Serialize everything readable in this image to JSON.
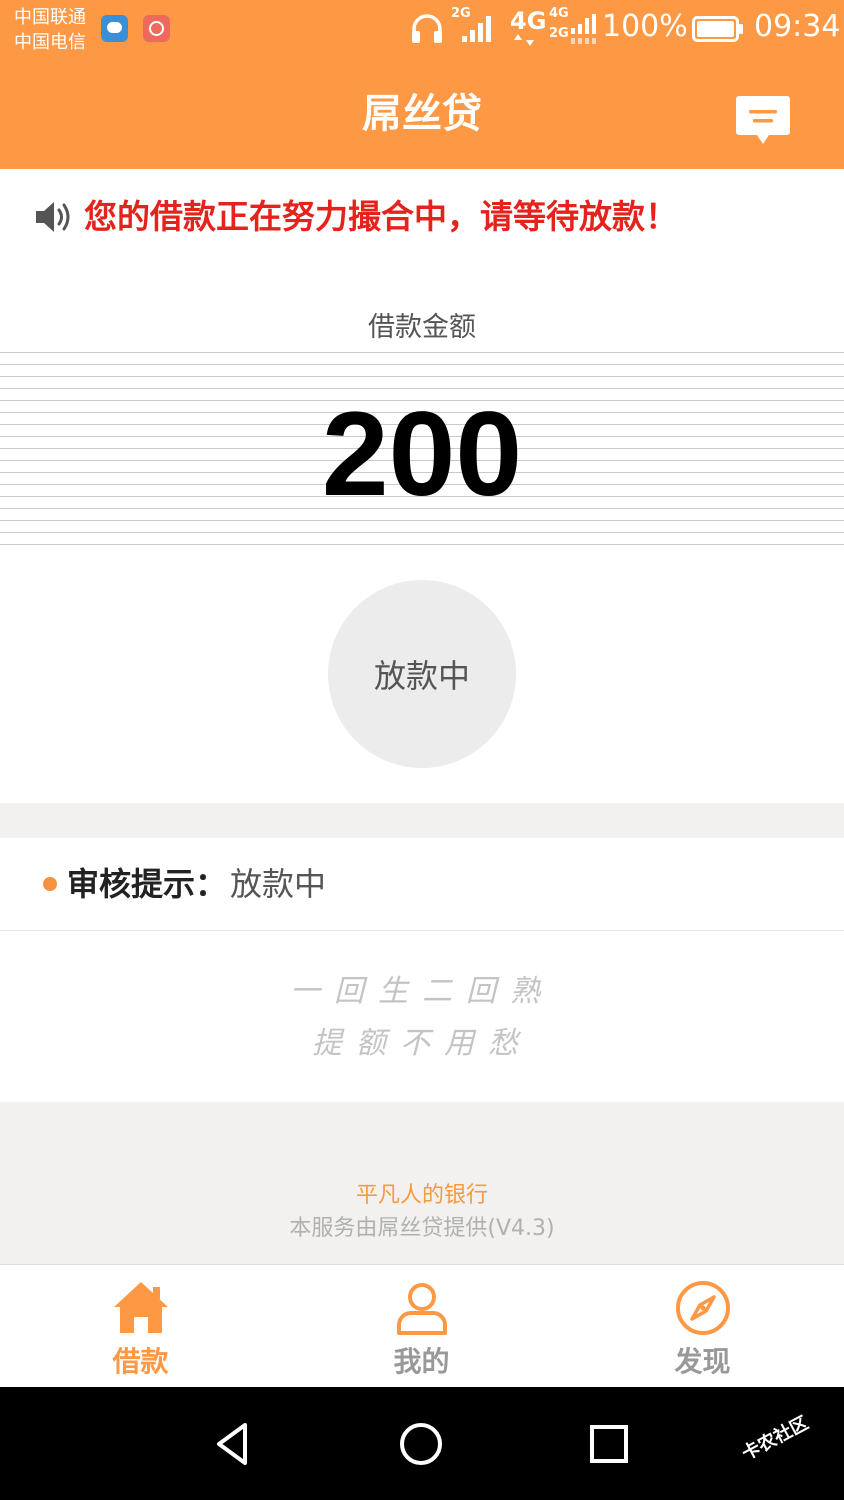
{
  "status_bar": {
    "carrier_1": "中国联通",
    "carrier_2": "中国电信",
    "net_2g": "2G",
    "net_4g": "4G",
    "net_4g_small": "4G",
    "net_2g_small": "2G",
    "battery": "100%",
    "time": "09:34"
  },
  "header": {
    "title": "屌丝贷",
    "message_icon": "message-icon"
  },
  "notice": {
    "icon": "speaker-icon",
    "text": "您的借款正在努力撮合中，请等待放款！"
  },
  "loan": {
    "amount_label": "借款金额",
    "amount": "200",
    "status": "放款中"
  },
  "review": {
    "label": "审核提示：",
    "value": "放款中"
  },
  "slogan": {
    "line_1": "一回生二回熟",
    "line_2": "提额不用愁"
  },
  "footer": {
    "brand": "平凡人的银行",
    "provider": "本服务由屌丝贷提供(V4.3)"
  },
  "bottom_nav": {
    "items": [
      {
        "label": "借款",
        "icon": "home-icon",
        "active": true
      },
      {
        "label": "我的",
        "icon": "user-icon",
        "active": false
      },
      {
        "label": "发现",
        "icon": "compass-icon",
        "active": false
      }
    ]
  },
  "colors": {
    "accent": "#fd9845",
    "notice_red": "#e5231d",
    "inactive_nav": "#999999"
  },
  "watermark": "卡农社区"
}
